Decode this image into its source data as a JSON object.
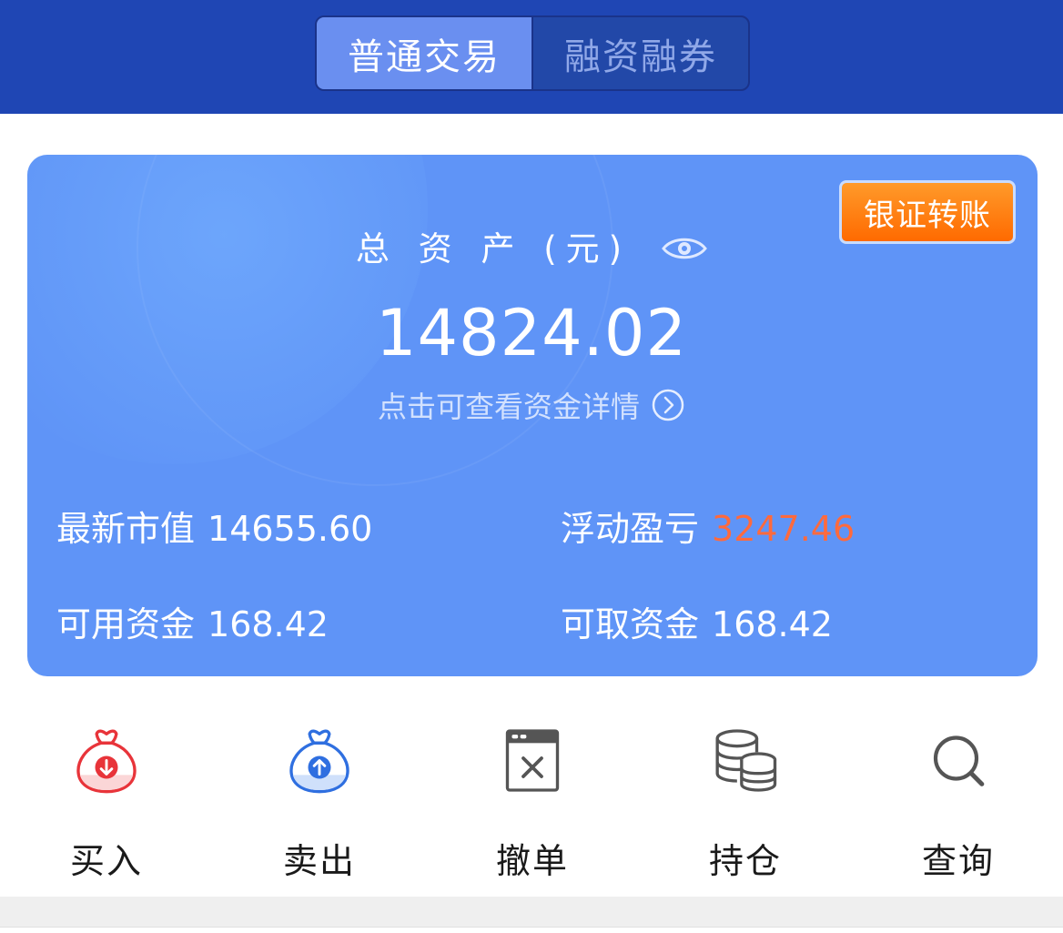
{
  "tabs": [
    {
      "label": "普通交易",
      "active": true
    },
    {
      "label": "融资融券",
      "active": false
    }
  ],
  "card": {
    "transfer_button": "银证转账",
    "total_assets_label": "总 资 产 (元)",
    "total_assets_value": "14824.02",
    "detail_link": "点击可查看资金详情",
    "stats": {
      "market_value_label": "最新市值",
      "market_value": "14655.60",
      "float_pl_label": "浮动盈亏",
      "float_pl": "3247.46",
      "available_funds_label": "可用资金",
      "available_funds": "168.42",
      "withdrawable_funds_label": "可取资金",
      "withdrawable_funds": "168.42"
    },
    "colors": {
      "card_bg": "#5f94f7",
      "loss": "#ff6a3d",
      "transfer_bg": "#ff7a10"
    }
  },
  "actions": [
    {
      "label": "买入",
      "icon": "buy-bag-icon"
    },
    {
      "label": "卖出",
      "icon": "sell-bag-icon"
    },
    {
      "label": "撤单",
      "icon": "cancel-order-icon"
    },
    {
      "label": "持仓",
      "icon": "coins-stack-icon"
    },
    {
      "label": "查询",
      "icon": "search-icon"
    }
  ],
  "colors": {
    "header_bg": "#1f46b4",
    "buy_red": "#e8343a",
    "sell_blue": "#2f6fe0"
  }
}
